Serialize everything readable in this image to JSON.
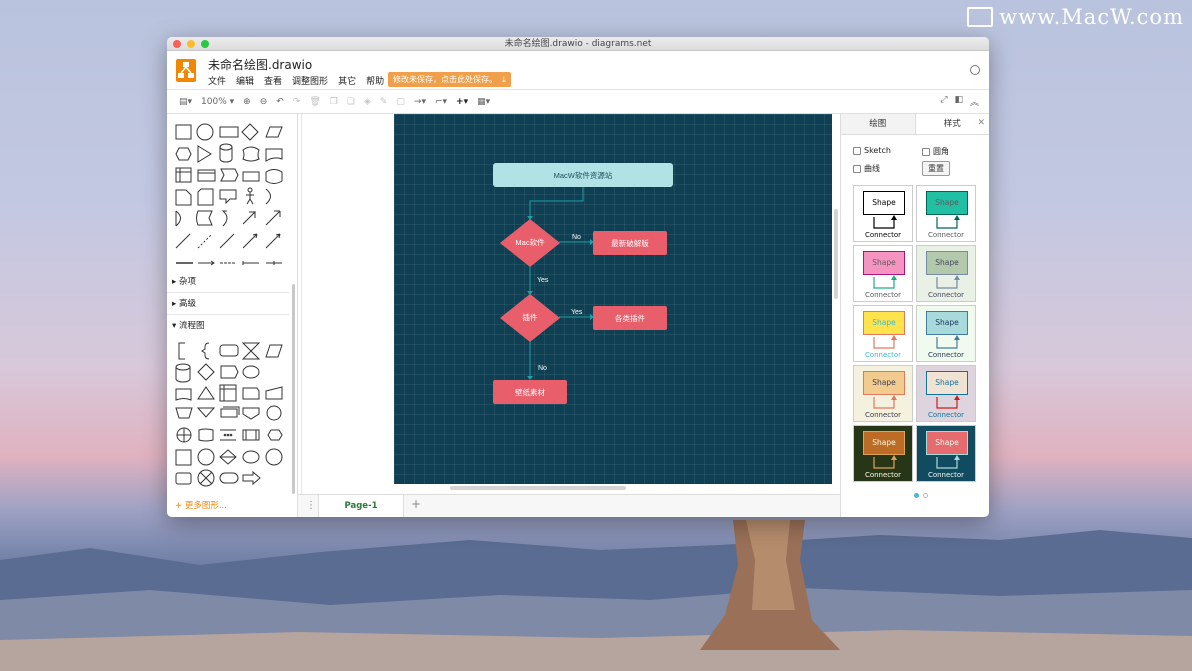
{
  "watermark": "www.MacW.com",
  "window": {
    "title": "未命名绘图.drawio - diagrams.net",
    "doc_title": "未命名绘图.drawio",
    "menus": [
      "文件",
      "编辑",
      "查看",
      "调整图形",
      "其它",
      "帮助"
    ],
    "unsaved_notice": "修改未保存，点击此处保存。"
  },
  "toolbar": {
    "zoom": "100%"
  },
  "left_panel": {
    "sections": [
      "杂项",
      "高级",
      "流程图"
    ],
    "more_shapes": "+ 更多图形..."
  },
  "diagram": {
    "nodes": {
      "top": "MacW软件资源站",
      "mac": "Mac软件",
      "crack": "最新破解版",
      "plugin": "插件",
      "plugins": "各类插件",
      "wallpaper": "壁纸素材"
    },
    "edges": {
      "no1": "No",
      "yes1": "Yes",
      "yes2": "Yes",
      "no2": "No"
    }
  },
  "page_tab": "Page-1",
  "right_panel": {
    "tabs": [
      "绘图",
      "样式"
    ],
    "sketch": "Sketch",
    "rounded": "圆角",
    "curved": "曲线",
    "reset": "重置",
    "style_presets": [
      {
        "shape": "Shape",
        "connector": "Connector",
        "fill": "#ffffff",
        "stroke": "#000000",
        "text": "#000000",
        "bg": "#ffffff",
        "line": "#000000"
      },
      {
        "shape": "Shape",
        "connector": "Connector",
        "fill": "#21c0a5",
        "stroke": "#006658",
        "text": "#5c5c5c",
        "bg": "#ffffff",
        "line": "#006658"
      },
      {
        "shape": "Shape",
        "connector": "Connector",
        "fill": "#f694c1",
        "stroke": "#a4148a",
        "text": "#5c5c5c",
        "bg": "#ffffff",
        "line": "#1aaf80"
      },
      {
        "shape": "Shape",
        "connector": "Connector",
        "fill": "#b2c9ab",
        "stroke": "#788aa3",
        "text": "#46495d",
        "bg": "#e9f0e6",
        "line": "#788aa3"
      },
      {
        "shape": "Shape",
        "connector": "Connector",
        "fill": "#fee34c",
        "stroke": "#e07a5f",
        "text": "#3fb9d6",
        "bg": "#ffffff",
        "line": "#e07a5f"
      },
      {
        "shape": "Shape",
        "connector": "Connector",
        "fill": "#a8dadc",
        "stroke": "#457b9d",
        "text": "#1d3557",
        "bg": "#f1faee",
        "line": "#457b9d"
      },
      {
        "shape": "Shape",
        "connector": "Connector",
        "fill": "#f2cc8f",
        "stroke": "#e07a5f",
        "text": "#393c56",
        "bg": "#f4f1de",
        "line": "#e07a5f"
      },
      {
        "shape": "Shape",
        "connector": "Connector",
        "fill": "#f1e3d3",
        "stroke": "#10739e",
        "text": "#10739e",
        "bg": "#ddd4dd",
        "line": "#cf1d1d"
      },
      {
        "shape": "Shape",
        "connector": "Connector",
        "fill": "#bc6c25",
        "stroke": "#dda15e",
        "text": "#fefae0",
        "bg": "#283618",
        "line": "#dda15e"
      },
      {
        "shape": "Shape",
        "connector": "Connector",
        "fill": "#e56b6f",
        "stroke": "#a8dadc",
        "text": "#f1faee",
        "bg": "#114b5f",
        "line": "#a8dadc"
      }
    ]
  },
  "colors": {
    "canvas": "#0e3f53",
    "node_light": "#b1e3e6",
    "node_red": "#e85e6b",
    "accent": "#f08705"
  }
}
